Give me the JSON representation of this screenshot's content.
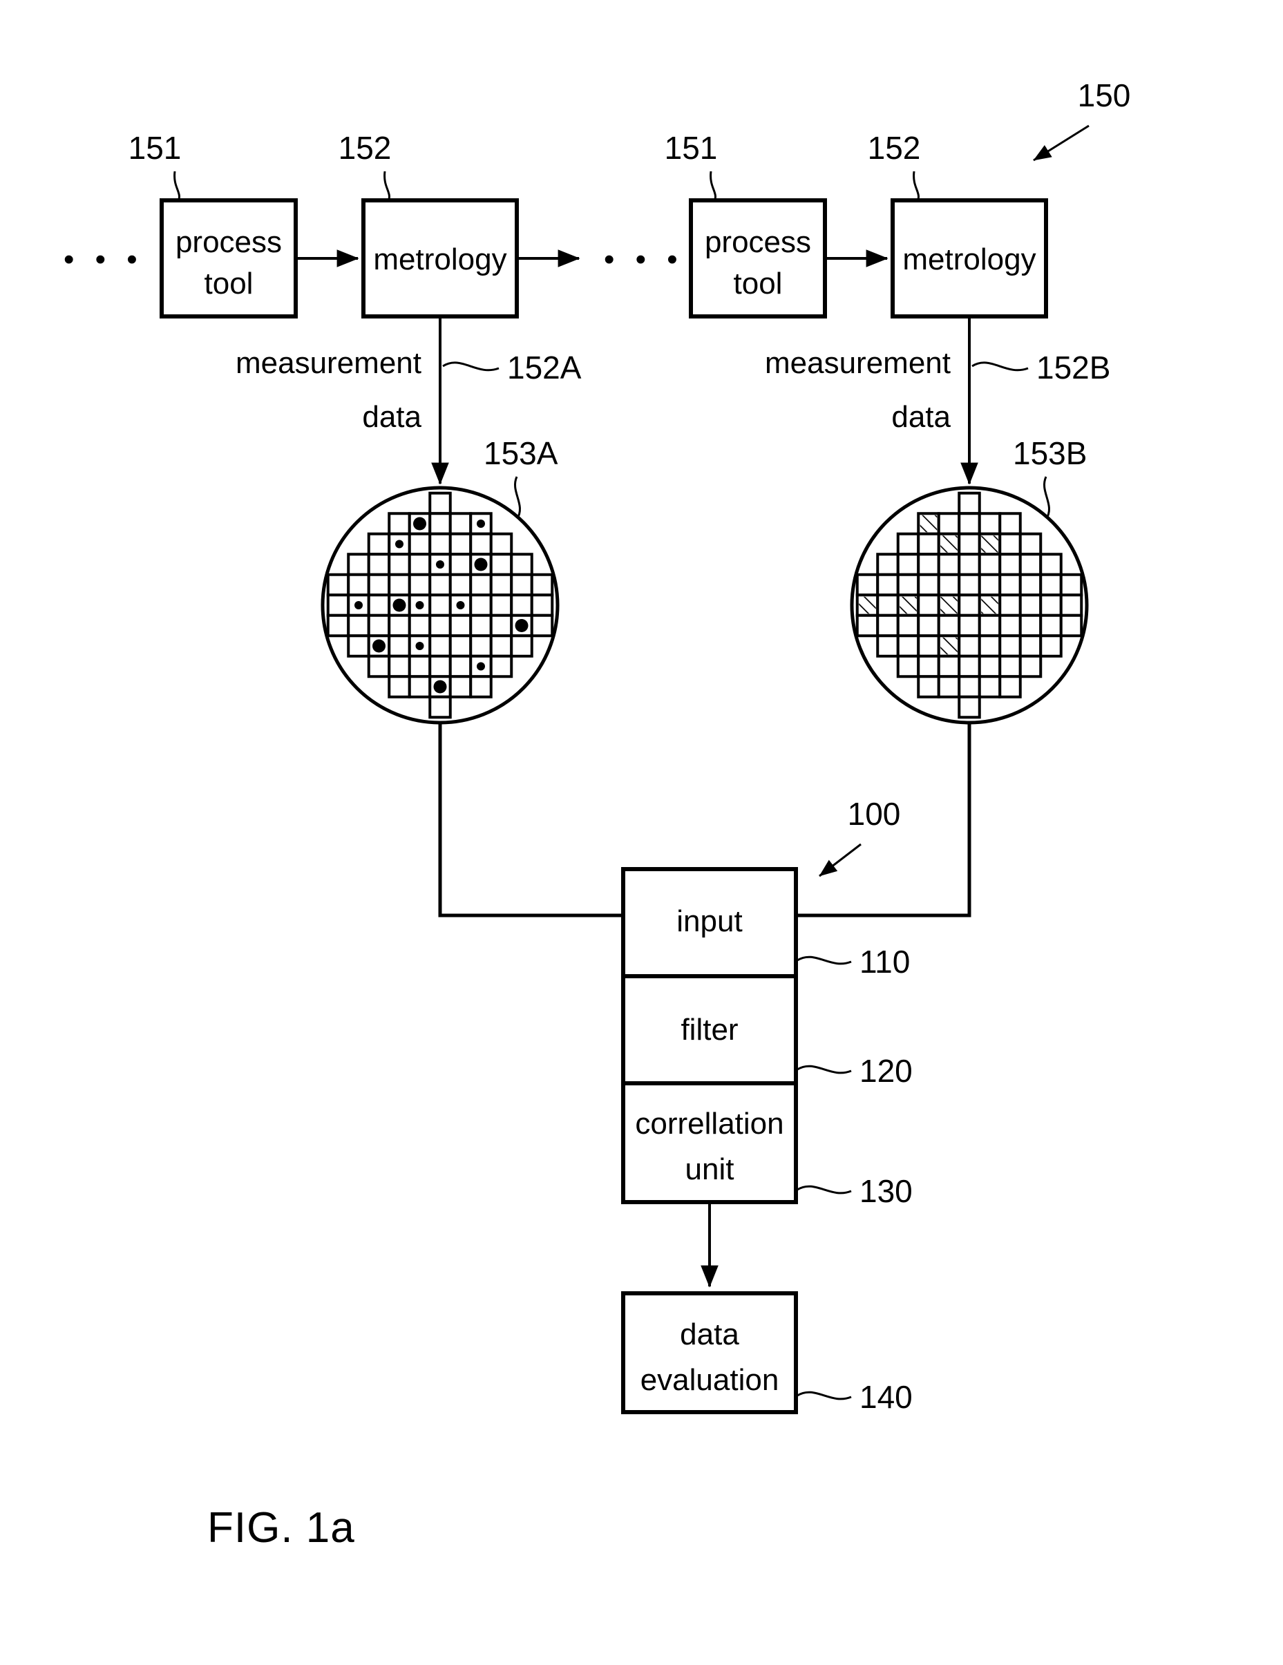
{
  "figure": {
    "caption": "FIG. 1a",
    "system_ref": "150",
    "analyzer_ref": "100"
  },
  "process_chains": [
    {
      "id": "chain-left",
      "ellipsis": "• • •",
      "process_tool": {
        "label_line1": "process",
        "label_line2": "tool",
        "ref": "151"
      },
      "metrology": {
        "label": "metrology",
        "ref": "152"
      },
      "data_flow": {
        "label_line1": "measurement",
        "label_line2": "data",
        "ref": "152A"
      },
      "wafer": {
        "ref": "153A",
        "marker_type": "dot"
      }
    },
    {
      "id": "chain-right",
      "ellipsis": "• • •",
      "process_tool": {
        "label_line1": "process",
        "label_line2": "tool",
        "ref": "151"
      },
      "metrology": {
        "label": "metrology",
        "ref": "152"
      },
      "data_flow": {
        "label_line1": "measurement",
        "label_line2": "data",
        "ref": "152B"
      },
      "wafer": {
        "ref": "153B",
        "marker_type": "hatch"
      }
    }
  ],
  "analyzer": {
    "ref": "100",
    "stages": [
      {
        "name": "input",
        "label_line1": "input",
        "label_line2": "",
        "ref": "110"
      },
      {
        "name": "filter",
        "label_line1": "filter",
        "label_line2": "",
        "ref": "120"
      },
      {
        "name": "correlation-unit",
        "label_line1": "correllation",
        "label_line2": "unit",
        "ref": "130"
      }
    ],
    "output": {
      "name": "data-evaluation",
      "label_line1": "data",
      "label_line2": "evaluation",
      "ref": "140"
    }
  },
  "wafer_maps": {
    "153A": {
      "grid_rows": 11,
      "grid_cols": 11,
      "row_spans": [
        [
          5,
          5
        ],
        [
          3,
          7
        ],
        [
          2,
          8
        ],
        [
          1,
          9
        ],
        [
          0,
          10
        ],
        [
          0,
          10
        ],
        [
          0,
          10
        ],
        [
          1,
          9
        ],
        [
          2,
          8
        ],
        [
          3,
          7
        ],
        [
          5,
          5
        ]
      ],
      "marked_cells": [
        {
          "row": 1,
          "col": 4,
          "size": "large"
        },
        {
          "row": 1,
          "col": 7,
          "size": "small"
        },
        {
          "row": 2,
          "col": 3,
          "size": "small"
        },
        {
          "row": 3,
          "col": 5,
          "size": "small"
        },
        {
          "row": 3,
          "col": 7,
          "size": "large"
        },
        {
          "row": 5,
          "col": 1,
          "size": "small"
        },
        {
          "row": 5,
          "col": 3,
          "size": "large"
        },
        {
          "row": 5,
          "col": 4,
          "size": "small"
        },
        {
          "row": 5,
          "col": 6,
          "size": "small"
        },
        {
          "row": 6,
          "col": 9,
          "size": "large"
        },
        {
          "row": 7,
          "col": 2,
          "size": "large"
        },
        {
          "row": 7,
          "col": 4,
          "size": "small"
        },
        {
          "row": 8,
          "col": 7,
          "size": "small"
        },
        {
          "row": 9,
          "col": 5,
          "size": "large"
        }
      ]
    },
    "153B": {
      "grid_rows": 11,
      "grid_cols": 11,
      "row_spans": [
        [
          5,
          5
        ],
        [
          3,
          7
        ],
        [
          2,
          8
        ],
        [
          1,
          9
        ],
        [
          0,
          10
        ],
        [
          0,
          10
        ],
        [
          0,
          10
        ],
        [
          1,
          9
        ],
        [
          2,
          8
        ],
        [
          3,
          7
        ],
        [
          5,
          5
        ]
      ],
      "hatched_cells": [
        {
          "row": 1,
          "col": 3
        },
        {
          "row": 2,
          "col": 4
        },
        {
          "row": 2,
          "col": 6
        },
        {
          "row": 5,
          "col": 0
        },
        {
          "row": 5,
          "col": 2
        },
        {
          "row": 5,
          "col": 4
        },
        {
          "row": 5,
          "col": 6
        },
        {
          "row": 7,
          "col": 4
        }
      ]
    }
  },
  "colors": {
    "ink": "#000000",
    "paper": "#ffffff"
  }
}
